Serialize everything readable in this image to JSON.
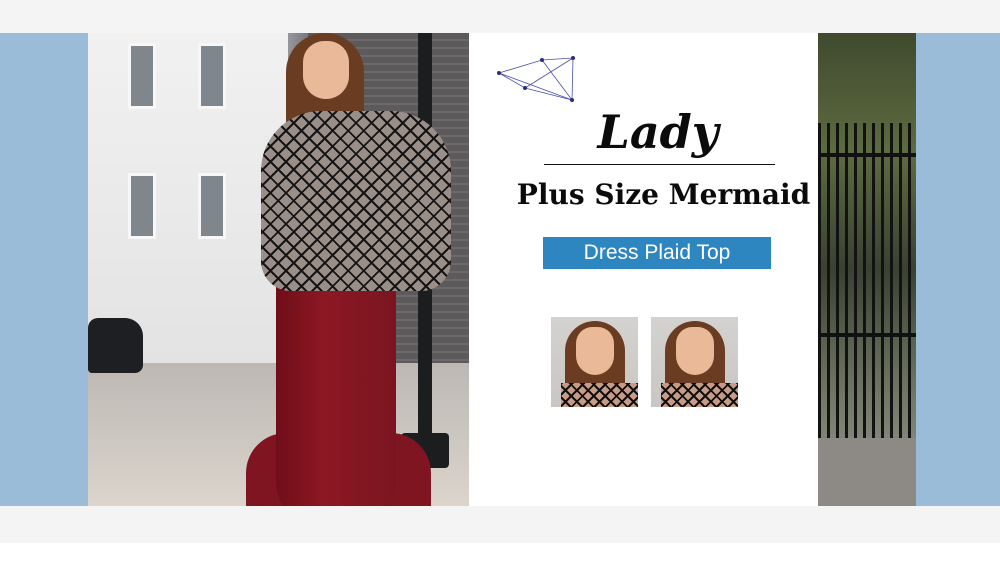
{
  "colors": {
    "side_panel_blue": "#9bbcd9",
    "tag_blue": "#2e86c1",
    "band_gray": "#f4f4f4"
  },
  "banner": {
    "title_script": "Lady",
    "title_main": "Plus Size Mermaid",
    "tag": "Dress Plaid Top"
  },
  "icons": {
    "decoration": "geometric-line-icon"
  }
}
